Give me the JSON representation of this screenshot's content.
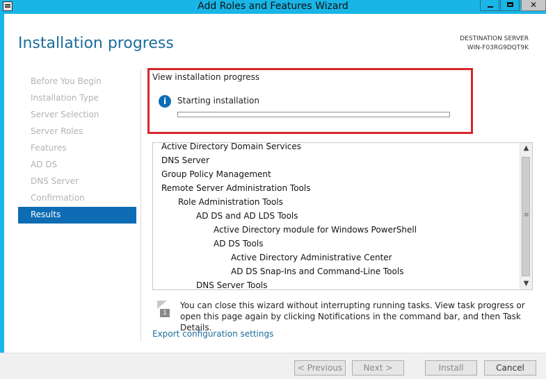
{
  "window": {
    "title": "Add Roles and Features Wizard"
  },
  "header": {
    "page_title": "Installation progress",
    "destination_label": "DESTINATION SERVER",
    "destination_server": "WIN-F03RG9DQT9K"
  },
  "nav": {
    "items": [
      {
        "label": "Before You Begin",
        "active": false
      },
      {
        "label": "Installation Type",
        "active": false
      },
      {
        "label": "Server Selection",
        "active": false
      },
      {
        "label": "Server Roles",
        "active": false
      },
      {
        "label": "Features",
        "active": false
      },
      {
        "label": "AD DS",
        "active": false
      },
      {
        "label": "DNS Server",
        "active": false
      },
      {
        "label": "Confirmation",
        "active": false
      },
      {
        "label": "Results",
        "active": true
      }
    ]
  },
  "progress": {
    "section_label": "View installation progress",
    "status": "Starting installation",
    "value": 0
  },
  "features_list": [
    {
      "label": "Active Directory Domain Services",
      "level": 0
    },
    {
      "label": "DNS Server",
      "level": 0
    },
    {
      "label": "Group Policy Management",
      "level": 0
    },
    {
      "label": "Remote Server Administration Tools",
      "level": 0
    },
    {
      "label": "Role Administration Tools",
      "level": 1
    },
    {
      "label": "AD DS and AD LDS Tools",
      "level": 2
    },
    {
      "label": "Active Directory module for Windows PowerShell",
      "level": 3
    },
    {
      "label": "AD DS Tools",
      "level": 3
    },
    {
      "label": "Active Directory Administrative Center",
      "level": 4
    },
    {
      "label": "AD DS Snap-Ins and Command-Line Tools",
      "level": 4
    },
    {
      "label": "DNS Server Tools",
      "level": 2
    }
  ],
  "note": {
    "badge": "1",
    "text": "You can close this wizard without interrupting running tasks. View task progress or open this page again by clicking Notifications in the command bar, and then Task Details."
  },
  "export_link": "Export configuration settings",
  "buttons": {
    "previous": "< Previous",
    "next": "Next >",
    "install": "Install",
    "cancel": "Cancel"
  },
  "colors": {
    "title_bar": "#19b5e6",
    "accent": "#0d6cb3",
    "highlight_box": "#d6262b"
  },
  "icons": {
    "app": "server-manager-icon",
    "info": "info-icon",
    "note": "flag-notification-icon"
  }
}
